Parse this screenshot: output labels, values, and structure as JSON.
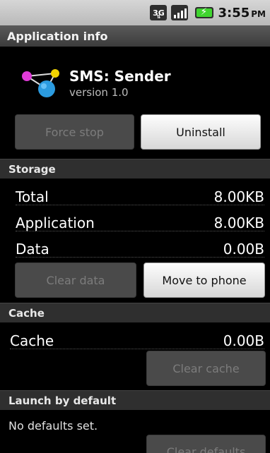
{
  "status_bar": {
    "network_badge": "3G",
    "time": "3:55",
    "ampm": "PM",
    "battery_color": "#3fd52f"
  },
  "title_bar": {
    "title": "Application info"
  },
  "app": {
    "name": "SMS: Sender",
    "version": "version 1.0",
    "icon": "molecule-app-icon"
  },
  "buttons": {
    "force_stop": "Force stop",
    "uninstall": "Uninstall",
    "clear_data": "Clear data",
    "move_to_phone": "Move to phone",
    "clear_cache": "Clear cache",
    "clear_defaults": "Clear defaults"
  },
  "storage": {
    "header": "Storage",
    "rows": [
      {
        "label": "Total",
        "value": "8.00KB"
      },
      {
        "label": "Application",
        "value": "8.00KB"
      },
      {
        "label": "Data",
        "value": "0.00B"
      }
    ]
  },
  "cache": {
    "header": "Cache",
    "label": "Cache",
    "value": "0.00B"
  },
  "launch": {
    "header": "Launch by default",
    "message": "No defaults set."
  }
}
